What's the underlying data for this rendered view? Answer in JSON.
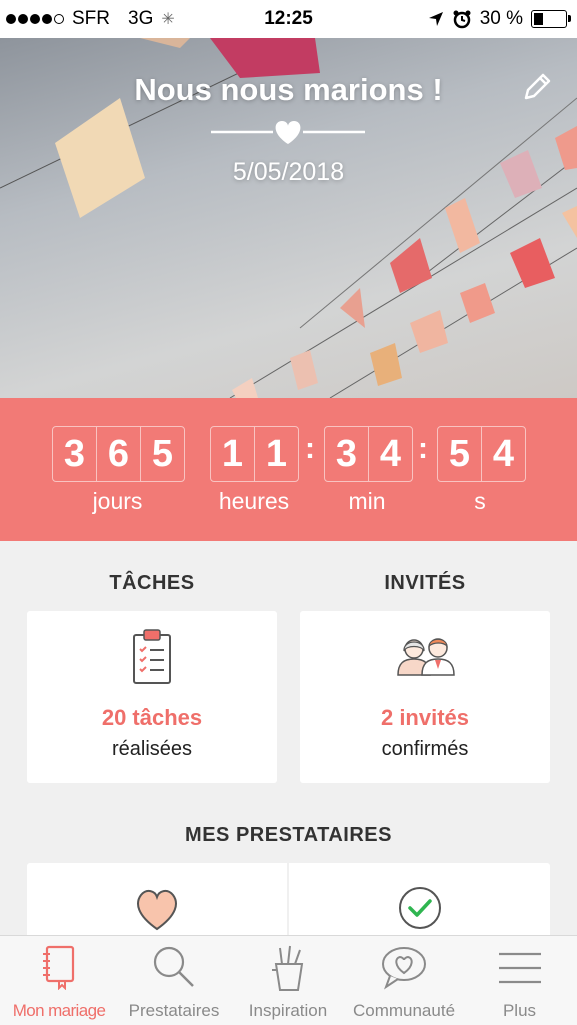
{
  "status_bar": {
    "carrier": "SFR",
    "network": "3G",
    "time": "12:25",
    "battery": "30 %"
  },
  "hero": {
    "title": "Nous nous marions !",
    "date": "5/05/2018"
  },
  "countdown": {
    "days": [
      "3",
      "6",
      "5"
    ],
    "hours": [
      "1",
      "1"
    ],
    "minutes": [
      "3",
      "4"
    ],
    "seconds": [
      "5",
      "4"
    ],
    "labels": {
      "days": "jours",
      "hours": "heures",
      "minutes": "min",
      "seconds": "s"
    },
    "separator": ":"
  },
  "tasks": {
    "heading": "TÂCHES",
    "count": "20 tâches",
    "caption": "réalisées"
  },
  "guests": {
    "heading": "INVITÉS",
    "count": "2 invités",
    "caption": "confirmés"
  },
  "vendors": {
    "heading": "MES PRESTATAIRES"
  },
  "tabs": [
    {
      "label": "Mon mariage",
      "icon": "notebook-icon",
      "active": true
    },
    {
      "label": "Prestataires",
      "icon": "search-icon",
      "active": false
    },
    {
      "label": "Inspiration",
      "icon": "pencil-cup-icon",
      "active": false
    },
    {
      "label": "Communauté",
      "icon": "heart-chat-icon",
      "active": false
    },
    {
      "label": "Plus",
      "icon": "menu-icon",
      "active": false
    }
  ],
  "colors": {
    "accent": "#f27a76",
    "accent_text": "#ef6f6a",
    "background": "#f0f0f0"
  }
}
